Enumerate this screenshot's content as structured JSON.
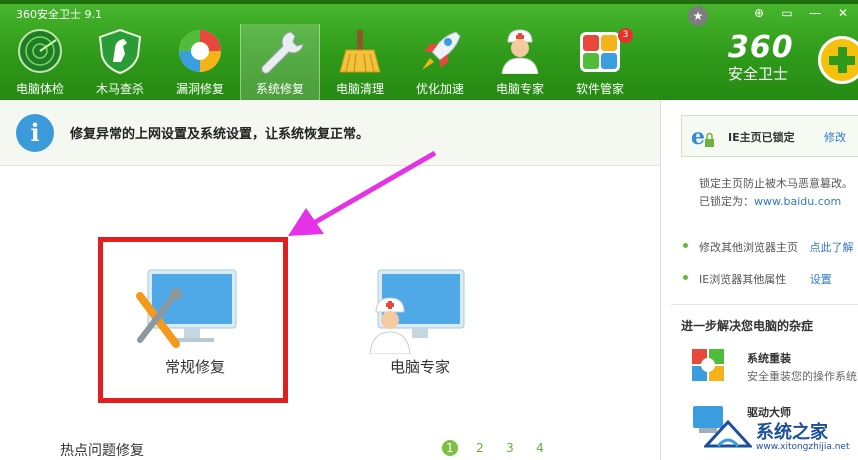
{
  "app": {
    "title": "360安全卫士 9.1"
  },
  "window_controls": [
    "⊕",
    "▭",
    "—",
    "✕"
  ],
  "nav": [
    {
      "label": "电脑体检",
      "icon": "radar-icon"
    },
    {
      "label": "木马查杀",
      "icon": "horse-shield-icon"
    },
    {
      "label": "漏洞修复",
      "icon": "patch-globe-icon"
    },
    {
      "label": "系统修复",
      "icon": "wrench-icon",
      "active": true
    },
    {
      "label": "电脑清理",
      "icon": "broom-icon"
    },
    {
      "label": "优化加速",
      "icon": "rocket-icon"
    },
    {
      "label": "电脑专家",
      "icon": "doctor-icon"
    },
    {
      "label": "软件管家",
      "icon": "software-grid-icon",
      "badge": "3"
    }
  ],
  "logo": {
    "number": "360",
    "name": "安全卫士"
  },
  "info": {
    "text": "修复异常的上网设置及系统设置，让系统恢复正常。"
  },
  "tools": {
    "normal_repair": "常规修复",
    "pc_expert": "电脑专家"
  },
  "hot": {
    "title": "热点问题修复",
    "pages": [
      "1",
      "2",
      "3",
      "4"
    ],
    "current_page": "1"
  },
  "right_panel": {
    "lock_title": "IE主页已锁定",
    "lock_edit": "修改",
    "lock_desc": "锁定主页防止被木马恶意篡改。",
    "locked_prefix": "已锁定为：",
    "locked_url": "www.baidu.com",
    "item1_text": "修改其他浏览器主页",
    "item1_link": "点此了解",
    "item2_text": "IE浏览器其他属性",
    "item2_link": "设置",
    "section_title": "进一步解决您电脑的杂症",
    "tool1_name": "系统重装",
    "tool1_desc": "安全重装您的操作系统",
    "tool2_name": "驱动大师"
  },
  "watermark": {
    "text": "系统之家",
    "url": "www.xitongzhijia.net"
  },
  "colors": {
    "brand_green": "#2f9a1a",
    "highlight_red": "#e21f1f",
    "arrow_magenta": "#e632e6",
    "link_blue": "#2f79c8"
  }
}
